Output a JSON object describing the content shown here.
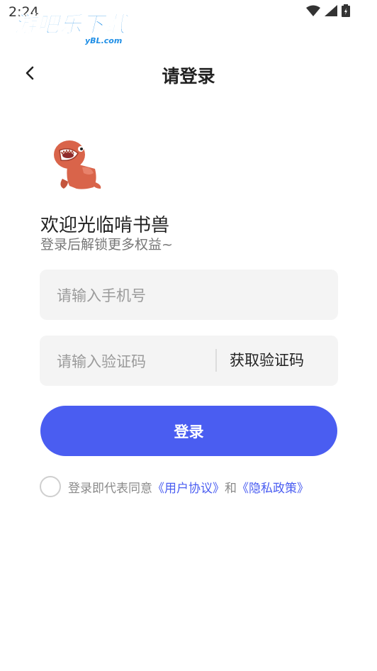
{
  "status_bar": {
    "time": "2:24"
  },
  "watermark": {
    "main": "游吧乐下载",
    "sub": "yBL.com"
  },
  "header": {
    "title": "请登录"
  },
  "welcome": {
    "title": "欢迎光临啃书兽",
    "subtitle": "登录后解锁更多权益~"
  },
  "form": {
    "phone_placeholder": "请输入手机号",
    "code_placeholder": "请输入验证码",
    "get_code_label": "获取验证码",
    "login_label": "登录"
  },
  "agreement": {
    "prefix": "登录即代表同意",
    "user_agreement": "《用户协议》",
    "conjunction": "和",
    "privacy_policy": "《隐私政策》"
  },
  "colors": {
    "accent": "#4a5df1",
    "field_bg": "#f4f4f4",
    "watermark": "#1e8ee6",
    "mascot": "#d9644a"
  }
}
